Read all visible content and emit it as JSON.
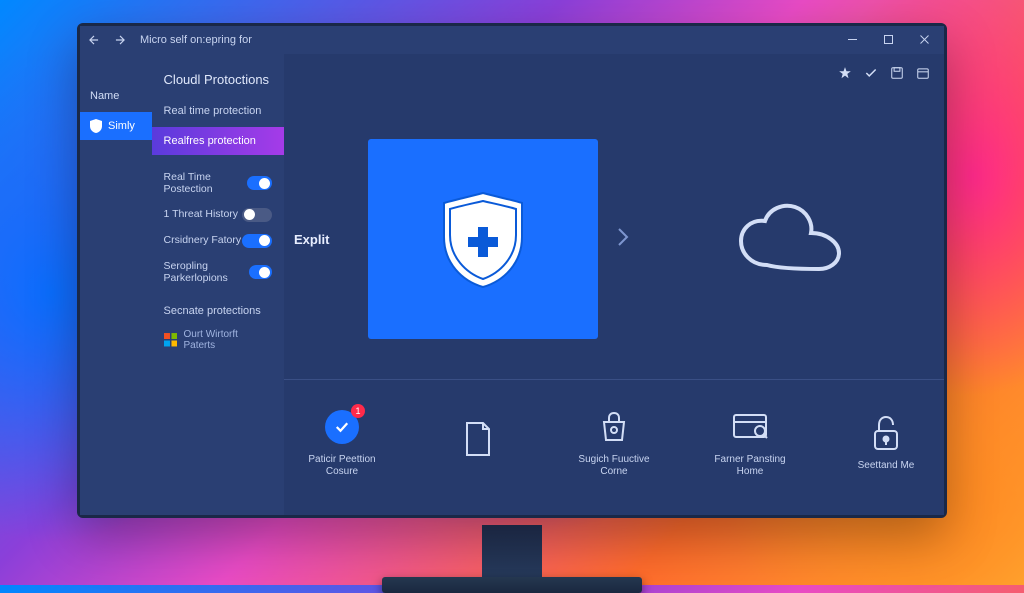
{
  "titlebar": {
    "title": "Micro self on:epring for"
  },
  "leftnav": {
    "header": "Name",
    "items": [
      {
        "label": "Simly",
        "active": true
      }
    ]
  },
  "settings": {
    "title": "Cloudl Protoctions",
    "subtitle": "Real time protection",
    "active_item": "Realfres protection",
    "toggles": [
      {
        "label": "Real Time Postection",
        "on": true
      },
      {
        "label": "1 Threat History",
        "on": false
      },
      {
        "label": "Crsidnery Fatory",
        "on": true
      },
      {
        "label": "Seropling Parkerlopions",
        "on": true
      }
    ],
    "section_label": "Secnate protections",
    "patents_label": "Ourt Wirtorft Paterts"
  },
  "main": {
    "expl_label": "Explit"
  },
  "cards": [
    {
      "label": "Paticir Peettion Cosure",
      "badge": "1",
      "type": "check"
    },
    {
      "label": "",
      "type": "doc"
    },
    {
      "label": "Sugich Fuuctive Corne",
      "type": "bag"
    },
    {
      "label": "Farner Pansting Home",
      "type": "card"
    },
    {
      "label": "Seettand Me",
      "type": "lock"
    }
  ]
}
